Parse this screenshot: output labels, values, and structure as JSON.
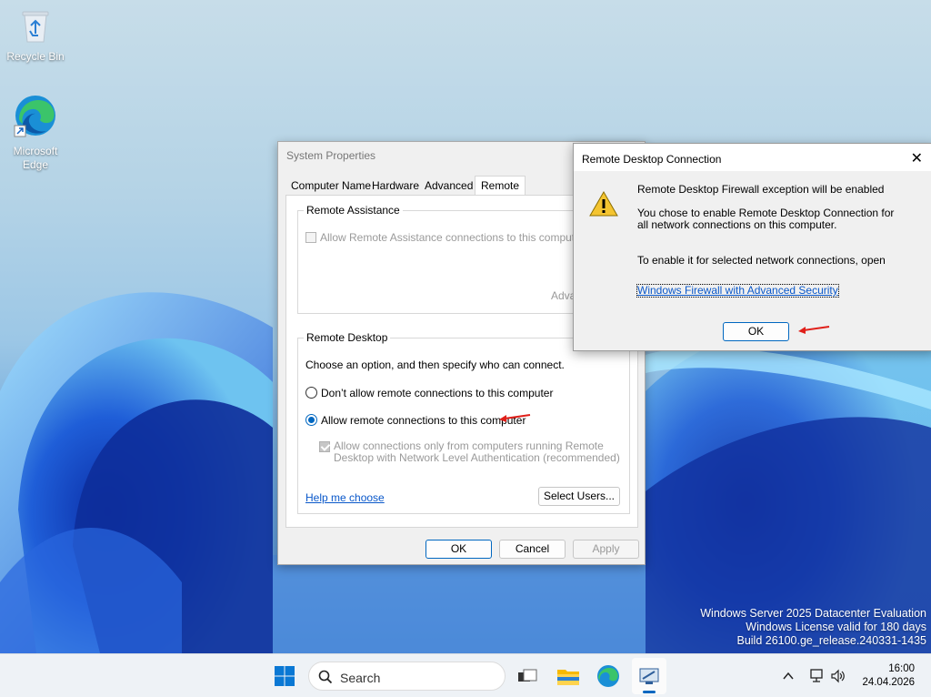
{
  "desktop": {
    "icons": [
      {
        "label": "Recycle Bin"
      },
      {
        "label_line1": "Microsoft",
        "label_line2": "Edge"
      }
    ],
    "watermark": [
      "Windows Server 2025 Datacenter Evaluation",
      "Windows License valid for 180 days",
      "Build 26100.ge_release.240331-1435"
    ]
  },
  "system_properties": {
    "title": "System Properties",
    "tabs": [
      "Computer Name",
      "Hardware",
      "Advanced",
      "Remote"
    ],
    "active_tab": "Remote",
    "remote_assistance": {
      "legend": "Remote Assistance",
      "allow_label": "Allow Remote Assistance connections to this computer",
      "allow_checked": false,
      "advanced_button": "Adva"
    },
    "remote_desktop": {
      "legend": "Remote Desktop",
      "instruction": "Choose an option, and then specify who can connect.",
      "option_dont": "Don’t allow remote connections to this computer",
      "option_allow": "Allow remote connections to this computer",
      "selected_option": "allow",
      "nla_line1": "Allow connections only from computers running Remote",
      "nla_line2": "Desktop with Network Level Authentication (recommended)",
      "nla_checked": true,
      "help_link": "Help me choose",
      "select_users_button": "Select Users..."
    },
    "buttons": {
      "ok": "OK",
      "cancel": "Cancel",
      "apply": "Apply"
    }
  },
  "rdc_dialog": {
    "title": "Remote Desktop Connection",
    "heading": "Remote Desktop Firewall exception will be enabled",
    "body_line1": "You chose to enable Remote Desktop Connection for",
    "body_line2": "all network connections on this computer.",
    "body_line3": "To enable it for selected network connections, open",
    "link": "Windows Firewall with Advanced Security",
    "ok": "OK",
    "close_glyph": "✕"
  },
  "taskbar": {
    "search_placeholder": "Search",
    "time": "16:00",
    "date": "24.04.2026"
  },
  "colors": {
    "accent": "#0067c0",
    "annotation_arrow": "#e0201a",
    "link": "#0a58ca"
  }
}
